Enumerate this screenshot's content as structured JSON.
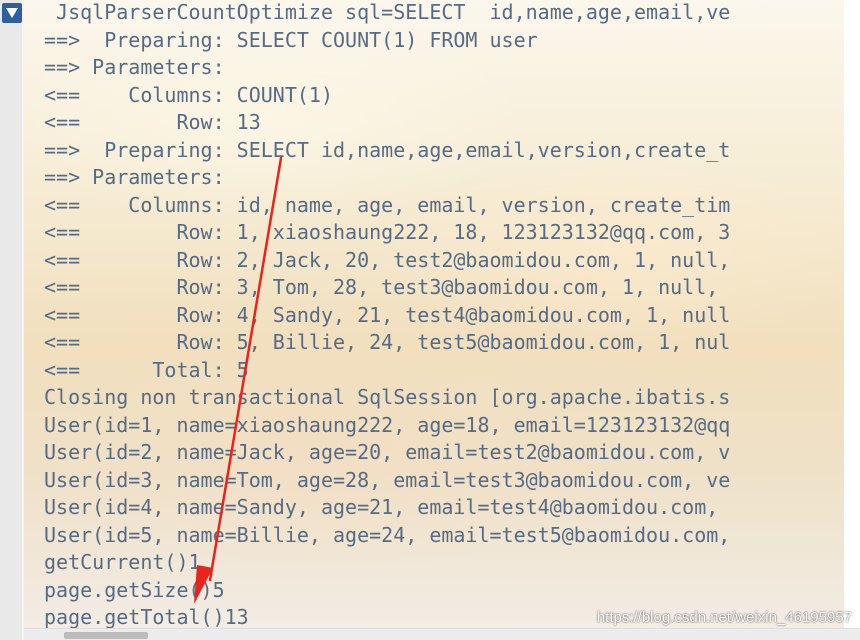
{
  "console": {
    "lines": [
      " JsqlParserCountOptimize sql=SELECT  id,name,age,email,ve",
      "==>  Preparing: SELECT COUNT(1) FROM user",
      "==> Parameters: ",
      "<==    Columns: COUNT(1)",
      "<==        Row: 13",
      "==>  Preparing: SELECT id,name,age,email,version,create_t",
      "==> Parameters: ",
      "<==    Columns: id, name, age, email, version, create_tim",
      "<==        Row: 1, xiaoshaung222, 18, 123123132@qq.com, 3",
      "<==        Row: 2, Jack, 20, test2@baomidou.com, 1, null,",
      "<==        Row: 3, Tom, 28, test3@baomidou.com, 1, null,",
      "<==        Row: 4, Sandy, 21, test4@baomidou.com, 1, null",
      "<==        Row: 5, Billie, 24, test5@baomidou.com, 1, nul",
      "<==      Total: 5",
      "Closing non transactional SqlSession [org.apache.ibatis.s",
      "User(id=1, name=xiaoshaung222, age=18, email=123123132@qq",
      "User(id=2, name=Jack, age=20, email=test2@baomidou.com, v",
      "User(id=3, name=Tom, age=28, email=test3@baomidou.com, ve",
      "User(id=4, name=Sandy, age=21, email=test4@baomidou.com,",
      "User(id=5, name=Billie, age=24, email=test5@baomidou.com,",
      "getCurrent()1",
      "page.getSize()5",
      "page.getTotal()13"
    ]
  },
  "watermark": "https://blog.csdn.net/weixin_46195957",
  "icons": {
    "collapse": "triangle-down-icon",
    "annotation": "red-arrow-icon"
  },
  "colors": {
    "log_text": "#566b85",
    "collapse_button": "#2e5f9e",
    "annotation_arrow": "#e8241c"
  }
}
